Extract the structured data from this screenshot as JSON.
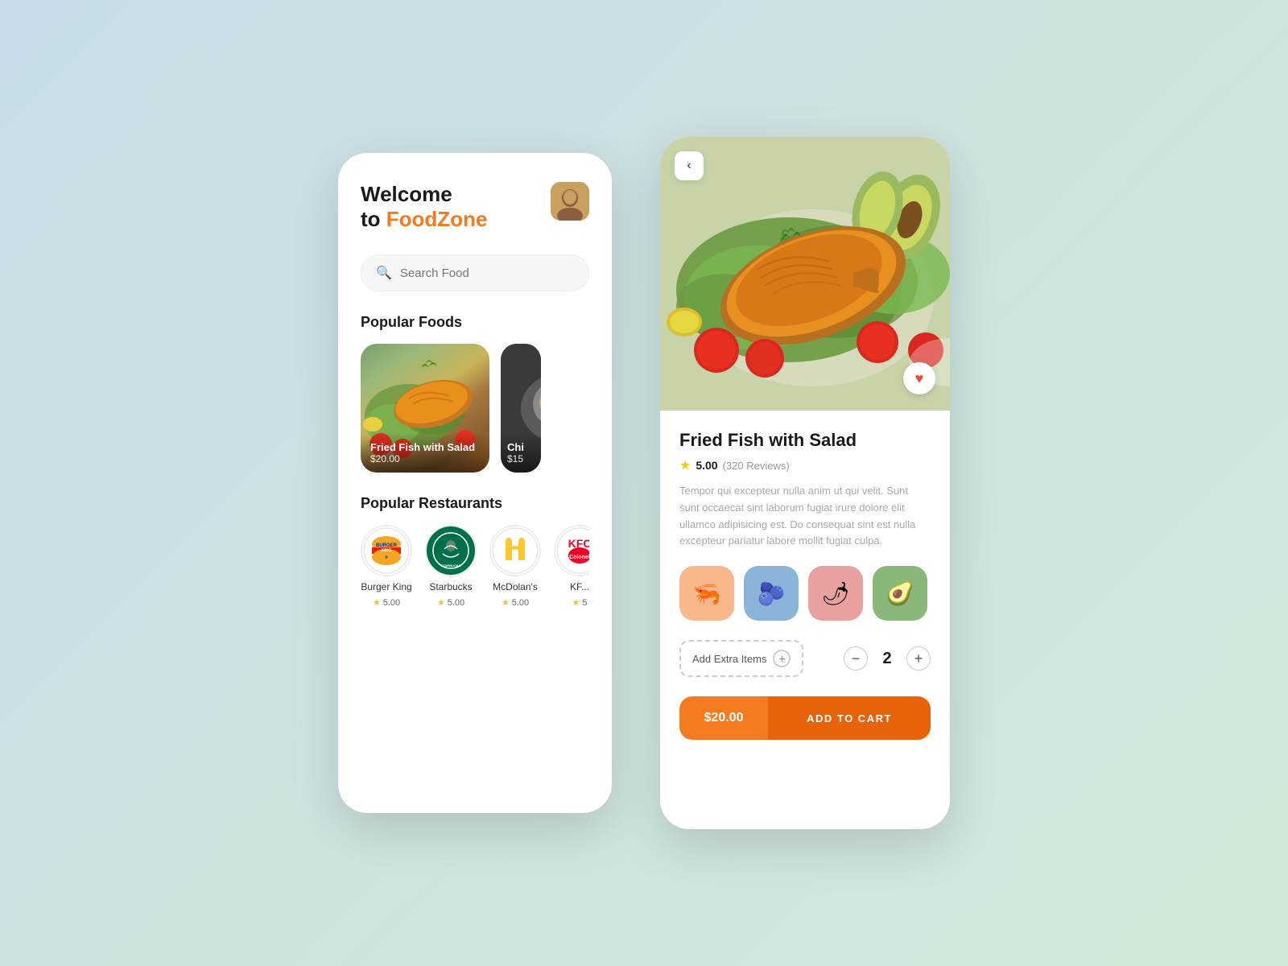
{
  "left_phone": {
    "welcome_line1": "Welcome",
    "welcome_line2": "to ",
    "brand": "FoodZone",
    "search_placeholder": "Search Food",
    "popular_foods_title": "Popular Foods",
    "foods": [
      {
        "name": "Fried Fish with Salad",
        "price": "$20.00",
        "type": "fish"
      },
      {
        "name": "Chi...",
        "price": "$15",
        "type": "chicken"
      }
    ],
    "popular_restaurants_title": "Popular Restaurants",
    "restaurants": [
      {
        "name": "Burger King",
        "rating": "5.00",
        "logo_type": "bk"
      },
      {
        "name": "Starbucks",
        "rating": "5.00",
        "logo_type": "starbucks"
      },
      {
        "name": "McDolan's",
        "rating": "5.00",
        "logo_type": "mcdonalds"
      },
      {
        "name": "KF...",
        "rating": "5",
        "logo_type": "kfc"
      }
    ]
  },
  "right_phone": {
    "back_label": "‹",
    "heart_icon": "♥",
    "title": "Fried Fish with Salad",
    "rating_score": "5.00",
    "rating_count": "(320 Reviews)",
    "description": "Tempor qui excepteur nulla anim ut qui velit. Sunt sunt occaecat sint laborum fugiat irure dolore elit ullamco adipisicing est. Do consequat sint est nulla excepteur pariatur labore mollit fugiat culpa.",
    "ingredients": [
      "🦐",
      "🫐",
      "🌶",
      "🥑"
    ],
    "extra_items_label": "Add Extra Items",
    "plus_label": "+",
    "minus_label": "−",
    "quantity": "2",
    "plus2_label": "+",
    "price_label": "$20.00",
    "add_to_cart_label": "ADD TO CART"
  }
}
